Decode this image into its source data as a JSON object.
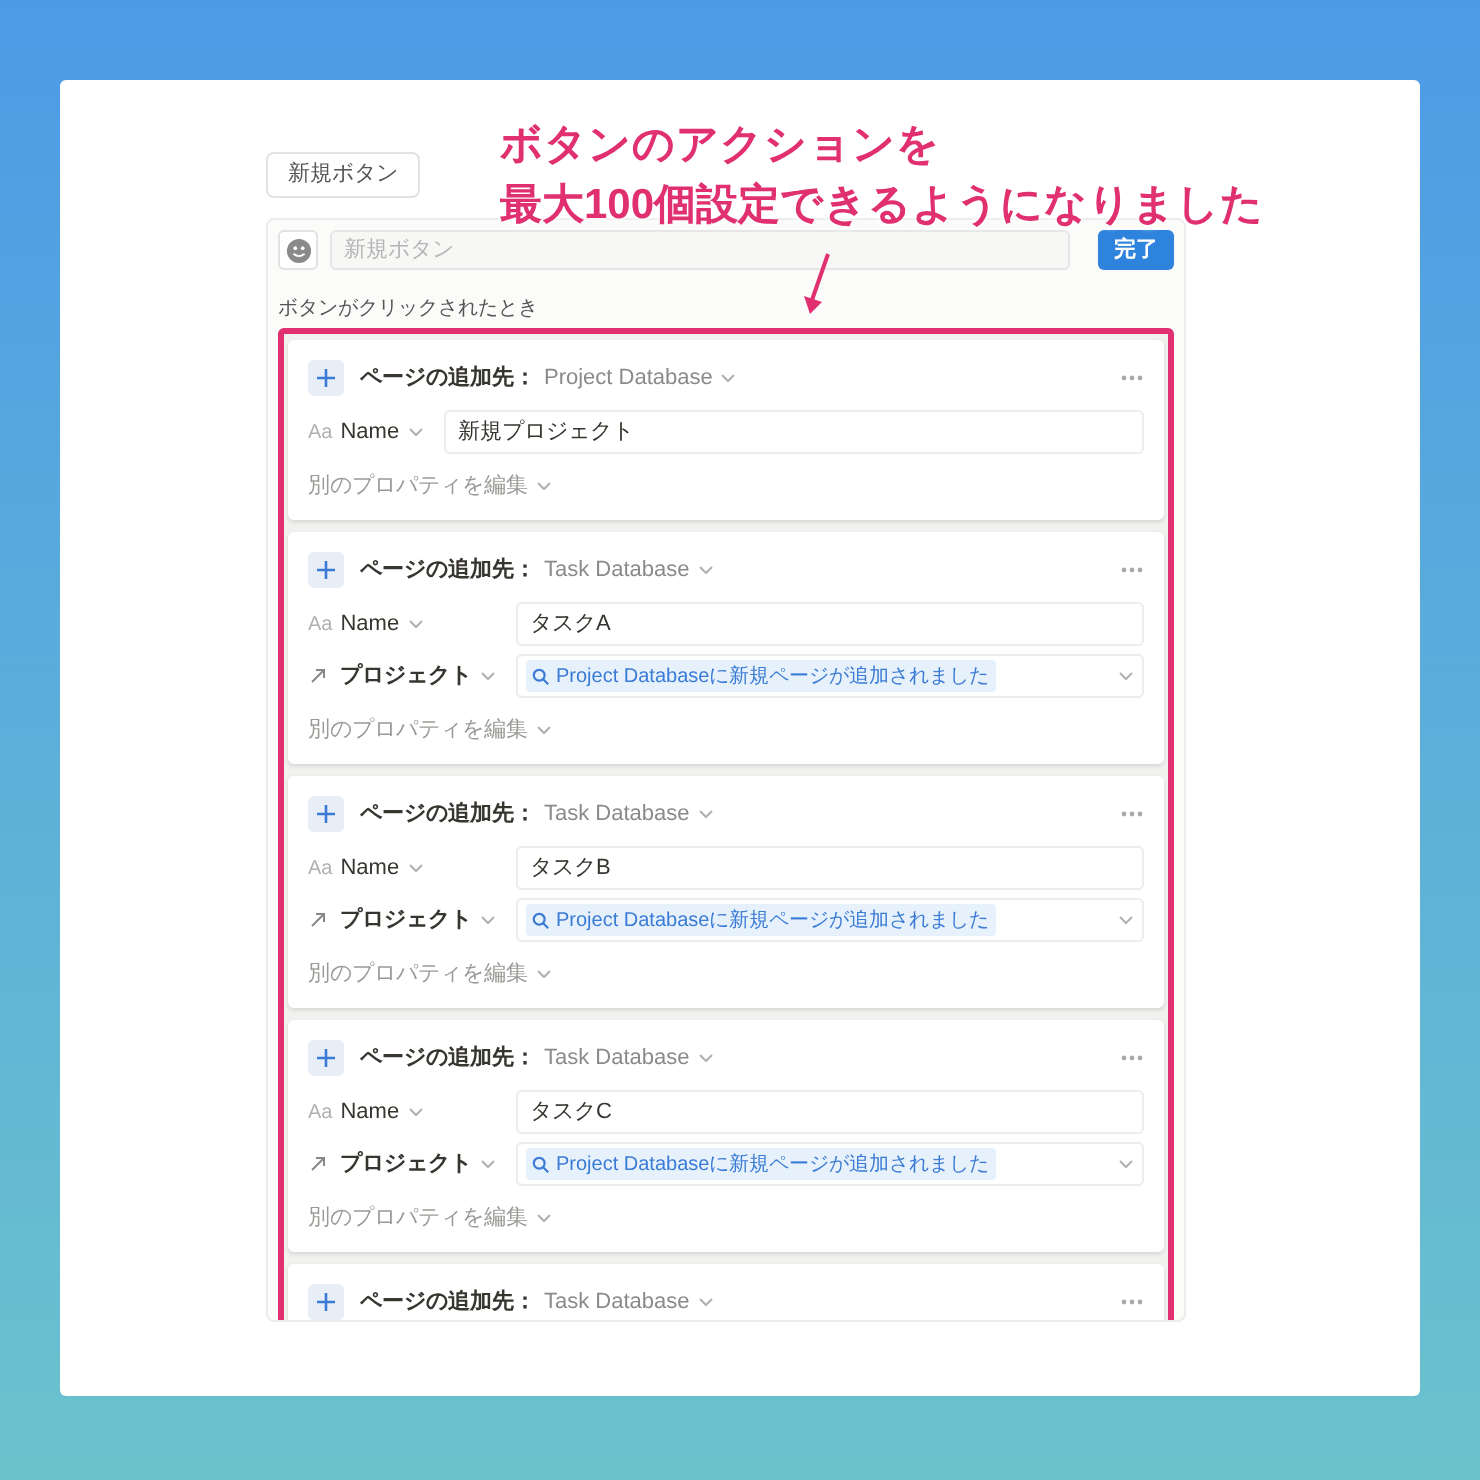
{
  "callout": {
    "lines": [
      "ボタンのアクションを",
      "最大100個設定できるようになりました"
    ]
  },
  "preview_button": "新規ボタン",
  "editor": {
    "name_placeholder": "新規ボタン",
    "done_button": "完了",
    "trigger_label": "ボタンがクリックされたとき"
  },
  "actions": [
    {
      "label": "ページの追加先：",
      "database": "Project Database",
      "properties": [
        {
          "kind": "title",
          "icon_text": "Aa",
          "name": "Name",
          "value": "新規プロジェクト"
        }
      ],
      "edit_more": "別のプロパティを編集"
    },
    {
      "label": "ページの追加先：",
      "database": "Task Database",
      "properties": [
        {
          "kind": "title",
          "icon_text": "Aa",
          "name": "Name",
          "value": "タスクA"
        },
        {
          "kind": "relation",
          "name": "プロジェクト",
          "value": "Project Databaseに新規ページが追加されました"
        }
      ],
      "edit_more": "別のプロパティを編集"
    },
    {
      "label": "ページの追加先：",
      "database": "Task Database",
      "properties": [
        {
          "kind": "title",
          "icon_text": "Aa",
          "name": "Name",
          "value": "タスクB"
        },
        {
          "kind": "relation",
          "name": "プロジェクト",
          "value": "Project Databaseに新規ページが追加されました"
        }
      ],
      "edit_more": "別のプロパティを編集"
    },
    {
      "label": "ページの追加先：",
      "database": "Task Database",
      "properties": [
        {
          "kind": "title",
          "icon_text": "Aa",
          "name": "Name",
          "value": "タスクC"
        },
        {
          "kind": "relation",
          "name": "プロジェクト",
          "value": "Project Databaseに新規ページが追加されました"
        }
      ],
      "edit_more": "別のプロパティを編集"
    },
    {
      "label": "ページの追加先：",
      "database": "Task Database"
    }
  ]
}
